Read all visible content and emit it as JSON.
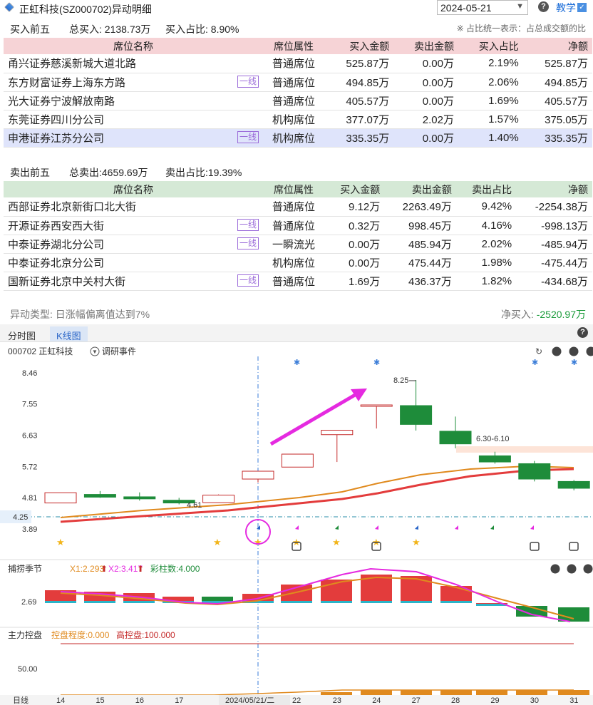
{
  "header": {
    "title": "正虹科技(SZ000702)异动明细",
    "date": "2024-05-21",
    "teach_label": "教学"
  },
  "buy": {
    "section_title": "买入前五",
    "total_label": "总买入: 2138.73万",
    "ratio_label": "买入占比: 8.90%",
    "note": "※ 占比统一表示：占总成交额的比",
    "columns": [
      "席位名称",
      "席位属性",
      "买入金额",
      "卖出金额",
      "买入占比",
      "净额"
    ],
    "rows": [
      {
        "name": "甬兴证券慈溪新城大道北路",
        "badge": "",
        "attr": "普通席位",
        "buy": "525.87万",
        "sell": "0.00万",
        "ratio": "2.19%",
        "net": "525.87万"
      },
      {
        "name": "东方财富证券上海东方路",
        "badge": "一线",
        "attr": "普通席位",
        "buy": "494.85万",
        "sell": "0.00万",
        "ratio": "2.06%",
        "net": "494.85万"
      },
      {
        "name": "光大证券宁波解放南路",
        "badge": "",
        "attr": "普通席位",
        "buy": "405.57万",
        "sell": "0.00万",
        "ratio": "1.69%",
        "net": "405.57万"
      },
      {
        "name": "东莞证券四川分公司",
        "badge": "",
        "attr": "机构席位",
        "buy": "377.07万",
        "sell": "2.02万",
        "ratio": "1.57%",
        "net": "375.05万"
      },
      {
        "name": "申港证券江苏分公司",
        "badge": "一线",
        "attr": "机构席位",
        "buy": "335.35万",
        "sell": "0.00万",
        "ratio": "1.40%",
        "net": "335.35万"
      }
    ]
  },
  "sell": {
    "section_title": "卖出前五",
    "total_label": "总卖出:4659.69万",
    "ratio_label": "卖出占比:19.39%",
    "columns": [
      "席位名称",
      "席位属性",
      "买入金额",
      "卖出金额",
      "卖出占比",
      "净额"
    ],
    "rows": [
      {
        "name": "西部证券北京新街口北大街",
        "badge": "",
        "attr": "普通席位",
        "buy": "9.12万",
        "sell": "2263.49万",
        "ratio": "9.42%",
        "net": "-2254.38万"
      },
      {
        "name": "开源证券西安西大街",
        "badge": "一线",
        "attr": "普通席位",
        "buy": "0.32万",
        "sell": "998.45万",
        "ratio": "4.16%",
        "net": "-998.13万"
      },
      {
        "name": "中泰证券湖北分公司",
        "badge": "一线",
        "attr": "一瞬流光",
        "buy": "0.00万",
        "sell": "485.94万",
        "ratio": "2.02%",
        "net": "-485.94万"
      },
      {
        "name": "中泰证券北京分公司",
        "badge": "",
        "attr": "机构席位",
        "buy": "0.00万",
        "sell": "475.44万",
        "ratio": "1.98%",
        "net": "-475.44万"
      },
      {
        "name": "国新证券北京中关村大街",
        "badge": "一线",
        "attr": "普通席位",
        "buy": "1.69万",
        "sell": "436.37万",
        "ratio": "1.82%",
        "net": "-434.68万"
      }
    ]
  },
  "summary": {
    "type_label": "异动类型: 日涨幅偏离值达到7%",
    "net_label": "净买入: ",
    "net_value": "-2520.97万"
  },
  "tabs": [
    "分时图",
    "K线图"
  ],
  "chart_data": {
    "type": "candlestick",
    "stock_label": "000702 正虹科技",
    "event_label": "调研事件",
    "price_ticks": [
      8.46,
      7.55,
      6.63,
      5.72,
      4.81,
      3.89
    ],
    "current_price_label": "4.25",
    "candles": [
      {
        "day": "14",
        "open": 4.65,
        "close": 4.95,
        "high": 4.95,
        "low": 4.65,
        "dir": "up"
      },
      {
        "day": "15",
        "open": 4.9,
        "close": 4.82,
        "high": 5.0,
        "low": 4.8,
        "dir": "down"
      },
      {
        "day": "16",
        "open": 4.83,
        "close": 4.77,
        "high": 4.96,
        "low": 4.72,
        "dir": "down"
      },
      {
        "day": "17",
        "open": 4.73,
        "close": 4.65,
        "high": 4.8,
        "low": 4.61,
        "dir": "down"
      },
      {
        "day": "20",
        "open": 4.66,
        "close": 4.88,
        "high": 4.9,
        "low": 4.66,
        "dir": "up"
      },
      {
        "day": "21",
        "open": 5.35,
        "close": 5.58,
        "high": 5.58,
        "low": 5.25,
        "dir": "up"
      },
      {
        "day": "22",
        "open": 5.7,
        "close": 6.08,
        "high": 6.08,
        "low": 5.7,
        "dir": "up"
      },
      {
        "day": "23",
        "open": 6.65,
        "close": 6.78,
        "high": 6.78,
        "low": 5.85,
        "dir": "up"
      },
      {
        "day": "24",
        "open": 7.48,
        "close": 7.52,
        "high": 7.52,
        "low": 6.83,
        "dir": "up"
      },
      {
        "day": "27",
        "open": 7.5,
        "close": 6.95,
        "high": 8.25,
        "low": 6.77,
        "dir": "down"
      },
      {
        "day": "28",
        "open": 6.75,
        "close": 6.38,
        "high": 7.18,
        "low": 6.25,
        "dir": "down"
      },
      {
        "day": "29",
        "open": 6.03,
        "close": 5.85,
        "high": 6.15,
        "low": 5.8,
        "dir": "down"
      },
      {
        "day": "30",
        "open": 5.8,
        "close": 5.35,
        "high": 5.88,
        "low": 5.28,
        "dir": "down"
      },
      {
        "day": "31",
        "open": 5.28,
        "close": 5.08,
        "high": 5.32,
        "low": 5.02,
        "dir": "down"
      }
    ],
    "annotations": {
      "high_label": "8.25",
      "low_label": "4.61",
      "zone_label": "6.30-6.10"
    },
    "cursor_date_label": "2024/05/21/二",
    "x_axis_prefix": "日线",
    "indicator1": {
      "name": "捕捞季节",
      "x1": "X1:2.293",
      "x2": "X2:3.417",
      "count": "彩柱数:4.000",
      "tick": "2.69"
    },
    "indicator2": {
      "name": "主力控盘",
      "level": "控盘程度:0.000",
      "high": "高控盘:100.000",
      "tick": "50.00"
    },
    "colors": {
      "up": "#c42a2a",
      "down": "#1e8c3a",
      "ma1": "#e08a1e",
      "ma2": "#e33c3c",
      "magenta": "#e52ae0",
      "accent": "#2a66c8"
    }
  }
}
